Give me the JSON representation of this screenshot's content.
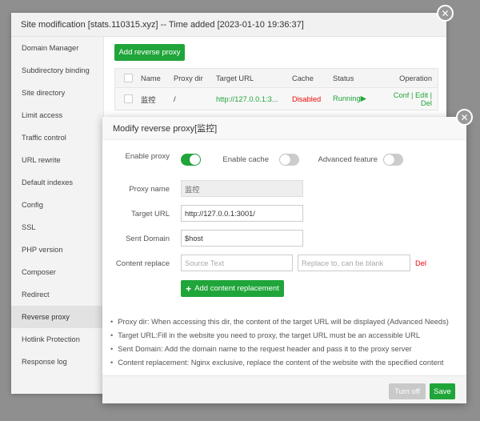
{
  "bg_dialog": {
    "title": "Site modification [stats.110315.xyz] -- Time added [2023-01-10 19:36:37]",
    "close_glyph": "✕",
    "sidebar": [
      {
        "label": "Domain Manager"
      },
      {
        "label": "Subdirectory binding"
      },
      {
        "label": "Site directory"
      },
      {
        "label": "Limit access"
      },
      {
        "label": "Traffic control"
      },
      {
        "label": "URL rewrite"
      },
      {
        "label": "Default indexes"
      },
      {
        "label": "Config"
      },
      {
        "label": "SSL"
      },
      {
        "label": "PHP version"
      },
      {
        "label": "Composer"
      },
      {
        "label": "Redirect"
      },
      {
        "label": "Reverse proxy",
        "active": true
      },
      {
        "label": "Hotlink Protection"
      },
      {
        "label": "Response log"
      }
    ],
    "add_button": "Add reverse proxy",
    "table": {
      "headers": {
        "name": "Name",
        "dir": "Proxy dir",
        "url": "Target URL",
        "cache": "Cache",
        "status": "Status",
        "op": "Operation"
      },
      "row": {
        "name": "监控",
        "dir": "/",
        "url": "http://127.0.0.1:3...",
        "cache": "Disabled",
        "status": "Running",
        "status_icon": "▶",
        "op_conf": "Conf",
        "sep": " | ",
        "op_edit": "Edit",
        "op_del": "Del"
      }
    }
  },
  "modal": {
    "title": "Modify reverse proxy[监控]",
    "close_glyph": "✕",
    "enable_proxy": {
      "label": "Enable proxy",
      "on": true
    },
    "enable_cache": {
      "label": "Enable cache",
      "on": false
    },
    "advanced": {
      "label": "Advanced feature",
      "on": false
    },
    "proxy_name": {
      "label": "Proxy name",
      "value": "监控"
    },
    "target_url": {
      "label": "Target URL",
      "value": "http://127.0.0.1:3001/"
    },
    "sent_domain": {
      "label": "Sent Domain",
      "value": "$host"
    },
    "content_replace": {
      "label": "Content replace",
      "source_placeholder": "Source Text",
      "replace_placeholder": "Replace to, can be blank",
      "del": "Del"
    },
    "add_replacement": {
      "icon": "+",
      "label": "Add content replacement"
    },
    "notes": [
      "Proxy dir: When accessing this dir, the content of the target URL will be displayed (Advanced Needs)",
      "Target URL:Fill in the website you need to proxy, the target URL must be an accessible URL",
      "Sent Domain: Add the domain name to the request header and pass it to the proxy server",
      "Content replacement: Nginx exclusive, replace the content of the website with the specified content"
    ],
    "turn_off": "Turn off",
    "save": "Save"
  },
  "colors": {
    "accent": "#20a53a",
    "danger": "#ef0808",
    "overlay": "#8f8f8f"
  }
}
